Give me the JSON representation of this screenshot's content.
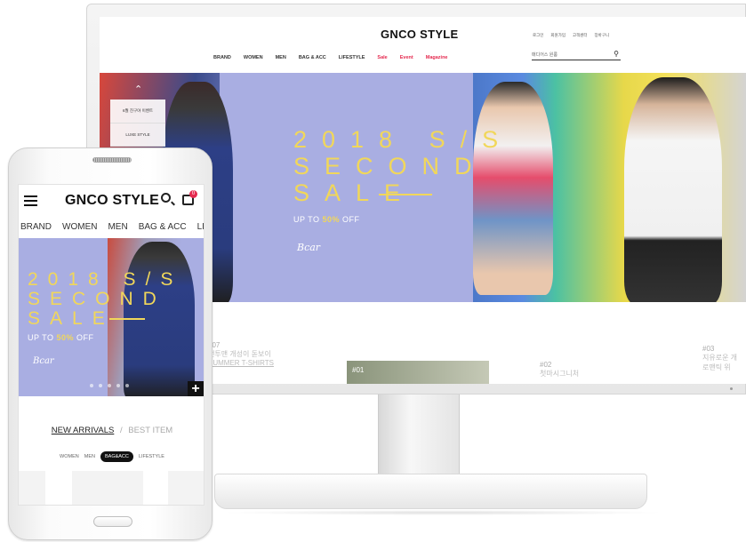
{
  "desktop": {
    "logo": "GNCO STYLE",
    "util_links": [
      "로그인",
      "회원가입",
      "고객센터",
      "장바구니"
    ],
    "nav": [
      "BRAND",
      "WOMEN",
      "MEN",
      "BAG & ACC",
      "LIFESTYLE",
      "Sale",
      "Event",
      "Magazine"
    ],
    "search_placeholder": "매디어스 원룸",
    "hero": {
      "line1": "2018 S/S",
      "line2": "SECOND",
      "line3": "SALE",
      "sub_pre": "UP TO ",
      "sub_bold": "50%",
      "sub_post": " OFF",
      "signature": "Bcar"
    },
    "side_items": [
      "6월 친구야 이벤트",
      "LUXE STYLE"
    ],
    "cards": [
      {
        "num": "#07",
        "t1": "맨투맨 개성이 돋보이",
        "t2": "SUMMER T-SHIRTS"
      },
      {
        "num": "#01",
        "t1": "",
        "t2": ""
      },
      {
        "num": "#02",
        "t1": "첫마시그니처",
        "t2": ""
      },
      {
        "num": "#03",
        "t1": "지유로운 개",
        "t2": "로맨틱 위"
      }
    ]
  },
  "mobile": {
    "logo": "GNCO STYLE",
    "cart_count": "0",
    "nav": [
      "BRAND",
      "WOMEN",
      "MEN",
      "BAG & ACC",
      "LIFESTYLE"
    ],
    "hero": {
      "line1": "2018 S/S",
      "line2": "SECOND",
      "line3": "SALE",
      "sub_pre": "UP TO ",
      "sub_bold": "50%",
      "sub_post": " OFF",
      "signature": "Bcar",
      "plus": "+"
    },
    "tabs": {
      "active": "NEW ARRIVALS",
      "separator": "/",
      "inactive": "BEST ITEM"
    },
    "categories": [
      "WOMEN",
      "MEN",
      "BAG&ACC",
      "LIFESTYLE"
    ],
    "selected_category": "BAG&ACC"
  },
  "colors": {
    "accent": "#e52b50",
    "hero_bg": "#a9aee2",
    "hero_text": "#f1d75a"
  }
}
